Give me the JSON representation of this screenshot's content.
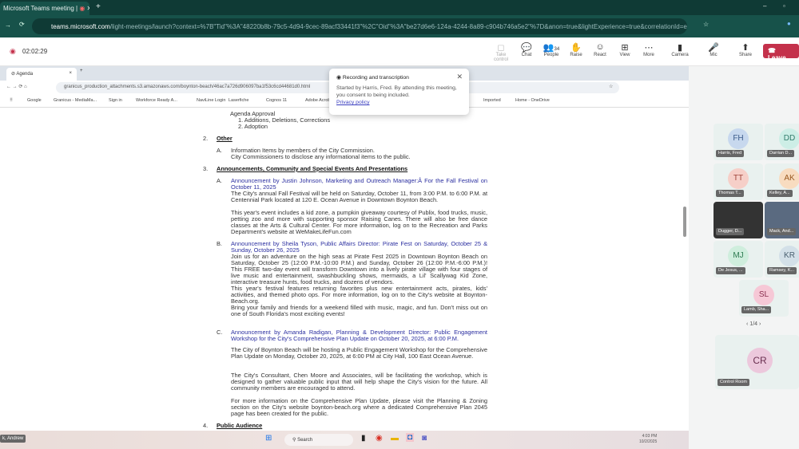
{
  "browser": {
    "tab_title": "Microsoft Teams meeting |",
    "url_host": "teams.microsoft.com",
    "url_path": "/light-meetings/launch?context=%7B\"Tid\"%3A\"48220b8b-79c5-4d94-9cec-89acf33441f3\"%2C\"Oid\"%3A\"be27d6e6-124a-4244-8a89-c904b746a5e2\"%7D&anon=true&lightExperience=true&correlationId=ebf8cc90-3dd..."
  },
  "meeting": {
    "timer": "02:02:29",
    "people_count": "34",
    "toolbar": [
      {
        "label": "Take control",
        "icon": "◻"
      },
      {
        "label": "Chat",
        "icon": "💬"
      },
      {
        "label": "People",
        "icon": "👥"
      },
      {
        "label": "Raise",
        "icon": "✋"
      },
      {
        "label": "React",
        "icon": "☺"
      },
      {
        "label": "View",
        "icon": "⊞"
      },
      {
        "label": "More",
        "icon": "⋯"
      },
      {
        "label": "Camera",
        "icon": "▮"
      },
      {
        "label": "Mic",
        "icon": "🎤"
      },
      {
        "label": "Share",
        "icon": "⬆"
      }
    ],
    "leave": "Leave"
  },
  "popup": {
    "title": "Recording and transcription",
    "body": "Started by Harris, Fred. By attending this meeting, you consent to being included.",
    "link": "Privacy policy"
  },
  "shared": {
    "tab": "Agenda",
    "url": "granicus_production_attachments.s3.amazonaws.com/boynton-beach/46ac7a726d906097ba1f53c6cd44681d0.html",
    "bookmarks": [
      "Google",
      "Granicus - MediaMa...",
      "Sign in",
      "Workforce Ready A...",
      "NaviLine Login",
      "Laserfiche",
      "Cognos 11",
      "Adobe Acrob",
      "Imported",
      "Home - OneDrive"
    ],
    "doc": {
      "agenda_approval": "Agenda Approval",
      "aa1": "1. Additions, Deletions, Corrections",
      "aa2": "2. Adoption",
      "s2_num": "2.",
      "s2": "Other",
      "s2a_l": "A.",
      "s2a1": "Information Items by members of the City Commission.",
      "s2a2": "City Commissioners to disclose any informational items to the public.",
      "s3_num": "3.",
      "s3": "Announcements, Community and Special Events And Presentations",
      "a_l": "A.",
      "a_title": "Announcement by Justin Johnson, Marketing and Outreach Manager:Â  For the Fall Festival on October 11, 2025",
      "a_p1": "The City's annual Fall Festival will be held on Saturday, October 11, from 3:00 P.M. to 6:00 P.M. at Centennial Park located at 120 E. Ocean Avenue in Downtown Boynton Beach.",
      "a_p2": "This year's event includes a kid zone, a pumpkin giveaway courtesy of Publix, food trucks, music, petting zoo and more with supporting sponsor Raising Canes. There will also be free dance classes at the Arts & Cultural Center. For more information, log on to the Recreation and Parks Department's website at WeMakeLifeFun.com",
      "b_l": "B.",
      "b_title": "Announcement by Sheila Tyson, Public Affairs Director: Pirate Fest on Saturday, October 25 & Sunday, October 26, 2025",
      "b_p1": "Join us for an adventure on the high seas at Pirate Fest 2025 in Downtown Boynton Beach on Saturday, October 25 (12:00 P.M.-10:00 P.M.) and Sunday, October 26 (12:00 P.M.-6:00 P.M.)! This FREE two-day event will transform Downtown into a lively pirate village with four stages of live music and entertainment, swashbuckling shows, mermaids, a Lil' Scallywag Kid Zone, interactive treasure hunts, food trucks, and dozens of vendors.",
      "b_p2": "This year's festival features returning favorites plus new entertainment acts, pirates, kids' activities, and themed photo ops. For more information, log on to the City's website at Boynton-Beach.org.",
      "b_p3": "Bring your family and friends for a weekend filled with music, magic, and fun. Don't miss out on one of South Florida's most exciting events!",
      "c_l": "C.",
      "c_title": "Announcement by Amanda Radigan, Planning & Development Director: Public Engagement Workshop for the City's Comprehensive Plan Update on October 20, 2025, at 6:00 P.M.",
      "c_p1": "The City of Boynton Beach will be hosting a Public Engagement Workshop for the Comprehensive Plan Update on Monday, October 20, 2025, at 6:00 PM at City Hall, 100 East Ocean Avenue.",
      "c_p2": "The City's Consultant, Chen Moore and Associates, will be facilitating the workshop, which is designed to gather valuable public input that will help shape the City's vision for the future. All community members are encouraged to attend.",
      "c_p3": "For more information on the Comprehensive Plan Update, please visit the Planning & Zoning section on the City's website boynton-beach.org where a dedicated Comprehensive Plan 2045 page has been created for the public.",
      "s4_num": "4.",
      "s4": "Public Audience"
    },
    "taskbar": {
      "search": "Search",
      "time": "4:03 PM",
      "date": "10/2/2025",
      "left_label": "k, Andrew"
    }
  },
  "participants": {
    "tiles": [
      {
        "initials": "FH",
        "name": "Harris, Fred",
        "color": "#c7d8ee",
        "text": "#3b5b8a"
      },
      {
        "initials": "DD",
        "name": "Darrian D...",
        "color": "#cdeee6",
        "text": "#2f7a6a"
      },
      {
        "initials": "TT",
        "name": "Thomas T...",
        "color": "#f6cfc8",
        "text": "#a0453a"
      },
      {
        "initials": "AK",
        "name": "Kelley, A...",
        "color": "#f8dcc0",
        "text": "#9a5a20"
      },
      {
        "initials": "",
        "name": "Dugger, D...",
        "color": "#333",
        "text": "#fff"
      },
      {
        "initials": "",
        "name": "Mack, And...",
        "color": "#5a6a80",
        "text": "#fff"
      },
      {
        "initials": "MJ",
        "name": "De Jesus, ...",
        "color": "#cfeedd",
        "text": "#2d7a50"
      },
      {
        "initials": "KR",
        "name": "Ramsey, K...",
        "color": "#d3e0e8",
        "text": "#4a6070"
      },
      {
        "initials": "SL",
        "name": "Lamb, Sha...",
        "color": "#f6c8d6",
        "text": "#8a2f50"
      }
    ],
    "page": "1/4",
    "control": {
      "initials": "CR",
      "name": "Control Room"
    }
  }
}
